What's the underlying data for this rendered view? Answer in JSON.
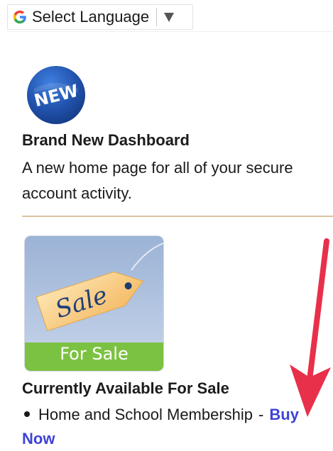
{
  "language_selector": {
    "label": "Select Language",
    "icon": "google-g-icon",
    "dropdown_icon": "triangle-down-icon"
  },
  "feature": {
    "badge_text": "NEW",
    "title": "Brand New Dashboard",
    "description": "A new home page for all of your secure account activity."
  },
  "sale": {
    "tag_text": "Sale",
    "banner_text": "For Sale",
    "section_title": "Currently Available For Sale",
    "items": [
      {
        "text": "Home and School Membership",
        "separator": "-",
        "link_label": "Buy Now"
      }
    ]
  },
  "colors": {
    "link": "#3f43d6",
    "divider": "#dcc3a0",
    "annotation_arrow": "#e8304a",
    "banner_green": "#7cc242",
    "badge_blue": "#1f4fa8"
  }
}
